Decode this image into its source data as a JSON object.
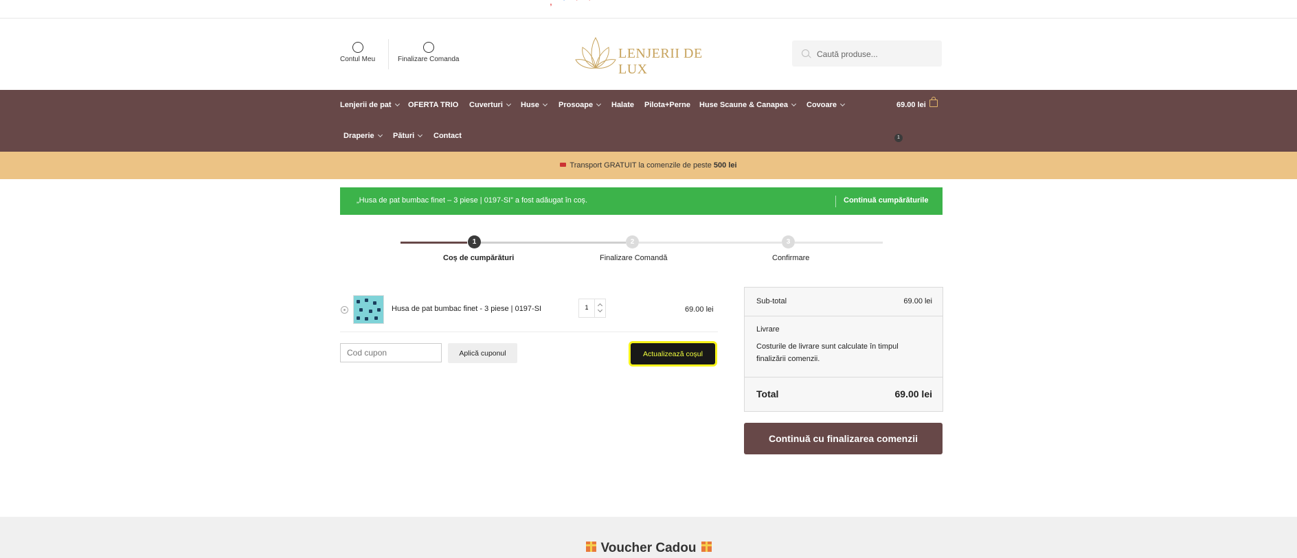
{
  "header": {
    "account_label": "Contul Meu",
    "checkout_label": "Finalizare Comanda",
    "logo_text": "LENJERII DE LUX",
    "search_placeholder": "Caută produse..."
  },
  "nav": {
    "items": [
      {
        "label": "Lenjerii de pat",
        "dropdown": true
      },
      {
        "label": "OFERTA TRIO",
        "dropdown": false
      },
      {
        "label": "Cuverturi",
        "dropdown": true
      },
      {
        "label": "Huse",
        "dropdown": true
      },
      {
        "label": "Prosoape",
        "dropdown": true
      },
      {
        "label": "Halate",
        "dropdown": false
      },
      {
        "label": "Pilota+Perne",
        "dropdown": false
      },
      {
        "label": "Huse Scaune & Canapea",
        "dropdown": true
      },
      {
        "label": "Covoare",
        "dropdown": true
      },
      {
        "label": "Draperie",
        "dropdown": true
      },
      {
        "label": "Pături",
        "dropdown": true
      },
      {
        "label": "Contact",
        "dropdown": false
      }
    ],
    "cart_total": "69.00 lei",
    "cart_count": "1"
  },
  "promo": {
    "text": "Transport GRATUIT la comenzile de peste",
    "amount": "500 lei"
  },
  "notice": {
    "message": "„Husa de pat bumbac finet – 3 piese | 0197-SI” a fost adăugat în coș.",
    "continue_label": "Continuă cumpărăturile"
  },
  "steps": [
    {
      "number": "1",
      "label": "Coș de cumpărături",
      "active": true
    },
    {
      "number": "2",
      "label": "Finalizare Comandă",
      "active": false
    },
    {
      "number": "3",
      "label": "Confirmare",
      "active": false
    }
  ],
  "cart": {
    "item": {
      "name": "Husa de pat bumbac finet - 3 piese | 0197-SI",
      "quantity": "1",
      "price": "69.00 lei"
    },
    "coupon_placeholder": "Cod cupon",
    "apply_label": "Aplică cuponul",
    "update_label": "Actualizează coșul"
  },
  "totals": {
    "subtotal_label": "Sub-total",
    "subtotal_value": "69.00 lei",
    "shipping_label": "Livrare",
    "shipping_note": "Costurile de livrare sunt calculate în timpul finalizării comenzii.",
    "total_label": "Total",
    "total_value": "69.00 lei"
  },
  "checkout_label": "Continuă cu finalizarea comenzii",
  "footer": {
    "voucher_title": "Voucher Cadou"
  },
  "colors": {
    "nav_bg": "#674848",
    "promo_bg": "#ecc385",
    "notice_bg": "#3cb34a",
    "logo_gold": "#c7a35d"
  }
}
